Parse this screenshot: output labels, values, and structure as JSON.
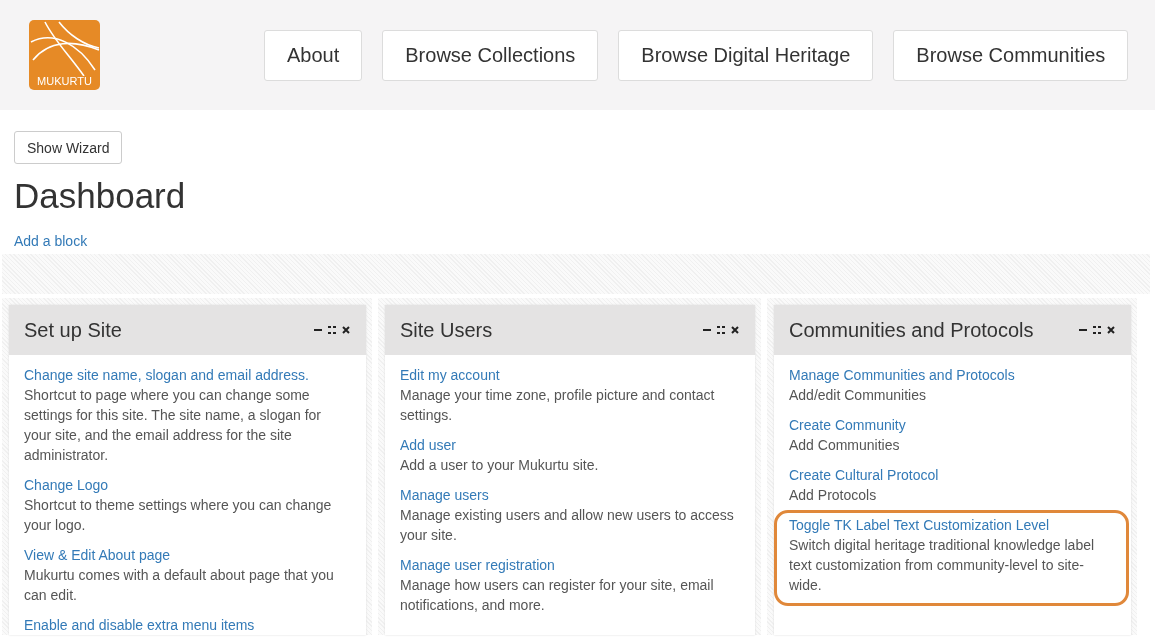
{
  "header": {
    "logo_text": "MUKURTU",
    "nav": [
      "About",
      "Browse Collections",
      "Browse Digital Heritage",
      "Browse Communities"
    ]
  },
  "show_wizard": "Show Wizard",
  "title": "Dashboard",
  "add_block": "Add a block",
  "panels": [
    {
      "title": "Set up Site",
      "items": [
        {
          "link": "Change site name, slogan and email address.",
          "description": "Shortcut to page where you can change some settings for this site. The site name, a slogan for your site, and the email address for the site administrator.",
          "highlighted": false
        },
        {
          "link": "Change Logo",
          "description": "Shortcut to theme settings where you can change your logo.",
          "highlighted": false
        },
        {
          "link": "View & Edit About page",
          "description": "Mukurtu comes with a default about page that you can edit.",
          "highlighted": false
        },
        {
          "link": "Enable and disable extra menu items",
          "highlighted": false
        }
      ]
    },
    {
      "title": "Site Users",
      "items": [
        {
          "link": "Edit my account",
          "description": "Manage your time zone, profile picture and contact settings.",
          "highlighted": false
        },
        {
          "link": "Add user",
          "description": "Add a user to your Mukurtu site.",
          "highlighted": false
        },
        {
          "link": "Manage users",
          "description": "Manage existing users and allow new users to access your site.",
          "highlighted": false
        },
        {
          "link": "Manage user registration",
          "description": "Manage how users can register for your site, email notifications, and more.",
          "highlighted": false
        }
      ]
    },
    {
      "title": "Communities and Protocols",
      "items": [
        {
          "link": "Manage Communities and Protocols",
          "description": "Add/edit Communities",
          "highlighted": false
        },
        {
          "link": "Create Community",
          "description": "Add Communities",
          "highlighted": false
        },
        {
          "link": "Create Cultural Protocol",
          "description": "Add Protocols",
          "highlighted": false
        },
        {
          "link": "Toggle TK Label Text Customization Level",
          "description": "Switch digital heritage traditional knowledge label text customization from community-level to site-wide.",
          "highlighted": true
        }
      ]
    }
  ]
}
